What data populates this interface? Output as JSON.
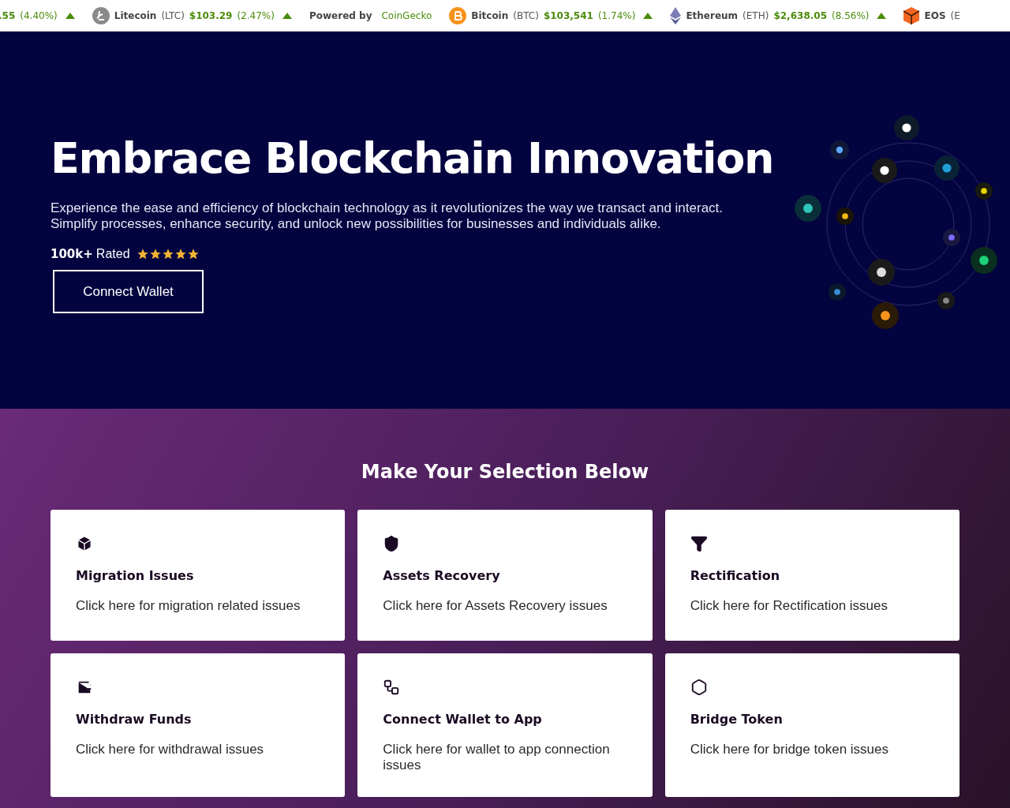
{
  "ticker": {
    "items": [
      {
        "kind": "coin",
        "price": ".55",
        "change": "(4.40%)",
        "up": true
      },
      {
        "kind": "coin",
        "name": "Litecoin",
        "symbol": "(LTC)",
        "price": "$103.29",
        "change": "(2.47%)",
        "up": true
      },
      {
        "kind": "powered",
        "label": "Powered by",
        "brand": "CoinGecko"
      },
      {
        "kind": "coin",
        "name": "Bitcoin",
        "symbol": "(BTC)",
        "price": "$103,541",
        "change": "(1.74%)",
        "up": true
      },
      {
        "kind": "coin",
        "name": "Ethereum",
        "symbol": "(ETH)",
        "price": "$2,638.05",
        "change": "(8.56%)",
        "up": true
      },
      {
        "kind": "coin",
        "name": "EOS",
        "symbol": "(E"
      }
    ]
  },
  "hero": {
    "title": "Embrace Blockchain Innovation",
    "text": "Experience the ease and efficiency of blockchain technology as it revolutionizes the way we transact and interact. Simplify processes, enhance security, and unlock new possibilities for businesses and individuals alike.",
    "rating": {
      "count": "100k+",
      "label": "Rated",
      "stars": 5
    },
    "button": "Connect Wallet"
  },
  "selection": {
    "heading": "Make Your Selection Below",
    "cards": [
      {
        "title": "Migration Issues",
        "text": "Click here for migration related issues"
      },
      {
        "title": "Assets Recovery",
        "text": "Click here for Assets Recovery issues"
      },
      {
        "title": "Rectification",
        "text": "Click here for Rectification issues"
      },
      {
        "title": "Withdraw Funds",
        "text": "Click here for withdrawal issues"
      },
      {
        "title": "Connect Wallet to App",
        "text": "Click here for wallet to app connection issues"
      },
      {
        "title": "Bridge Token",
        "text": "Click here for bridge token issues"
      }
    ]
  }
}
